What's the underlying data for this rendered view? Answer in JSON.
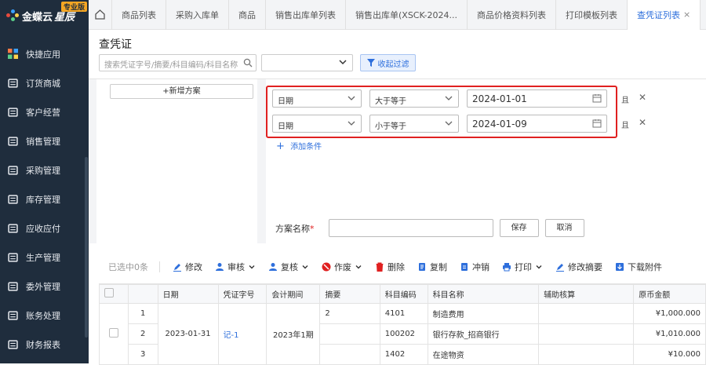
{
  "brand": {
    "name": "金蝶云",
    "product": "星辰",
    "badge": "专业版"
  },
  "sidebar": {
    "items": [
      {
        "label": "快捷应用",
        "icon": "grid-icon"
      },
      {
        "label": "订货商城",
        "icon": "bag-icon"
      },
      {
        "label": "客户经营",
        "icon": "users-icon"
      },
      {
        "label": "销售管理",
        "icon": "chart-icon"
      },
      {
        "label": "采购管理",
        "icon": "cart-icon"
      },
      {
        "label": "库存管理",
        "icon": "box-icon"
      },
      {
        "label": "应收应付",
        "icon": "coin-icon"
      },
      {
        "label": "生产管理",
        "icon": "factory-icon"
      },
      {
        "label": "委外管理",
        "icon": "outsource-icon"
      },
      {
        "label": "账务处理",
        "icon": "ledger-icon"
      },
      {
        "label": "财务报表",
        "icon": "report-icon"
      }
    ]
  },
  "tabs": [
    {
      "label": "商品列表"
    },
    {
      "label": "采购入库单"
    },
    {
      "label": "商品"
    },
    {
      "label": "销售出库单列表"
    },
    {
      "label": "销售出库单(XSCK-2024..."
    },
    {
      "label": "商品价格资料列表"
    },
    {
      "label": "打印模板列表"
    },
    {
      "label": "查凭证列表",
      "close": "×"
    }
  ],
  "page": {
    "title": "查凭证"
  },
  "search": {
    "placeholder": "搜索凭证字号/摘要/科目编码/科目名称"
  },
  "collapse_label": "收起过滤",
  "filter": {
    "add_scheme": "+新增方案",
    "conditions": [
      {
        "field": "日期",
        "op": "大于等于",
        "value": "2024-01-01",
        "and": "并且"
      },
      {
        "field": "日期",
        "op": "小于等于",
        "value": "2024-01-09",
        "and": "并且"
      }
    ],
    "add_condition": "添加条件",
    "scheme_name_label": "方案名称",
    "required_mark": "*",
    "save": "保存",
    "cancel": "取消"
  },
  "toolbar": {
    "selected": "已选中0条",
    "edit": "修改",
    "audit": "审核",
    "recheck": "复核",
    "void": "作废",
    "delete": "删除",
    "copy": "复制",
    "offset": "冲销",
    "print": "打印",
    "edit_summary": "修改摘要",
    "download": "下载附件"
  },
  "table": {
    "headers": [
      "日期",
      "凭证字号",
      "会计期间",
      "摘要",
      "科目编码",
      "科目名称",
      "辅助核算",
      "原币金额"
    ],
    "voucher": {
      "date": "2023-01-31",
      "no": "记-1",
      "period": "2023年1期",
      "summary": "2"
    },
    "rows": [
      {
        "idx": "1",
        "code": "4101",
        "name": "制造费用",
        "amount": "¥1,000.000"
      },
      {
        "idx": "2",
        "code": "100202",
        "name": "银行存款_招商银行",
        "amount": "¥1,010.000"
      },
      {
        "idx": "3",
        "code": "1402",
        "name": "在途物资",
        "amount": "¥10.000"
      }
    ]
  },
  "colors": {
    "sidebar": "#1f2d3d",
    "accent": "#2e6fdc",
    "highlight": "#e02020",
    "badge": "#f5a623"
  }
}
